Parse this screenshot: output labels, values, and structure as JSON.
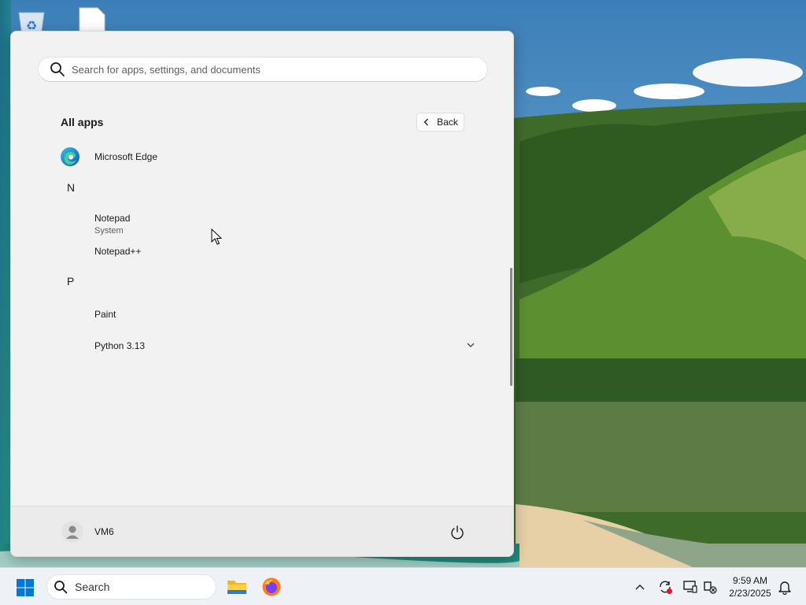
{
  "start_menu": {
    "search_placeholder": "Search for apps, settings, and documents",
    "section_title": "All apps",
    "back_label": "Back",
    "apps": [
      {
        "label": "Microsoft Edge",
        "icon": "edge-icon"
      },
      {
        "letter": "N"
      },
      {
        "label": "Notepad",
        "sublabel": "System",
        "icon": "none"
      },
      {
        "label": "Notepad++",
        "icon": "none"
      },
      {
        "letter": "P"
      },
      {
        "label": "Paint",
        "icon": "none"
      },
      {
        "label": "Python 3.13",
        "icon": "none",
        "expandable": true
      }
    ],
    "user": {
      "name": "VM6"
    }
  },
  "taskbar": {
    "search_label": "Search",
    "pinned": [
      "file-explorer-icon",
      "firefox-icon"
    ],
    "clock": {
      "time": "9:59 AM",
      "date": "2/23/2025"
    }
  },
  "colors": {
    "accent": "#0078d4",
    "menu_bg": "#f2f2f2",
    "taskbar_bg": "#eef1f6"
  }
}
